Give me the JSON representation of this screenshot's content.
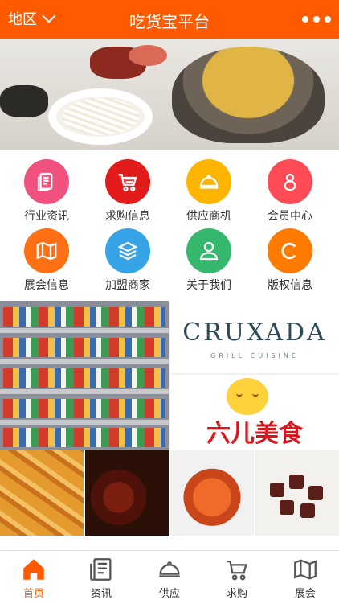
{
  "header": {
    "region_label": "地区",
    "title": "吃货宝平台",
    "background": "#ff5a00"
  },
  "grid": {
    "items": [
      {
        "label": "行业资讯",
        "icon": "document-icon",
        "color": "#f0517f"
      },
      {
        "label": "求购信息",
        "icon": "cart-icon",
        "color": "#e21b1b"
      },
      {
        "label": "供应商机",
        "icon": "cloche-icon",
        "color": "#ffb400"
      },
      {
        "label": "会员中心",
        "icon": "member-icon",
        "color": "#ff4b55"
      },
      {
        "label": "展会信息",
        "icon": "map-book-icon",
        "color": "#ff6f13"
      },
      {
        "label": "加盟商家",
        "icon": "layers-icon",
        "color": "#35a3e6"
      },
      {
        "label": "关于我们",
        "icon": "user-icon",
        "color": "#35b86d"
      },
      {
        "label": "版权信息",
        "icon": "copyright-icon",
        "color": "#ff7a00"
      }
    ]
  },
  "tiles": {
    "cruxada": {
      "wordmark": "CRUXADA",
      "sub": "GRILL CUISINE"
    },
    "liuer": {
      "wordmark": "六儿美食"
    }
  },
  "nav": {
    "items": [
      {
        "label": "首页",
        "icon": "home-icon",
        "active": true
      },
      {
        "label": "资讯",
        "icon": "news-icon",
        "active": false
      },
      {
        "label": "供应",
        "icon": "cloche-icon",
        "active": false
      },
      {
        "label": "求购",
        "icon": "cart-icon",
        "active": false
      },
      {
        "label": "展会",
        "icon": "map-book-icon",
        "active": false
      }
    ],
    "active_color": "#ff5a00"
  }
}
